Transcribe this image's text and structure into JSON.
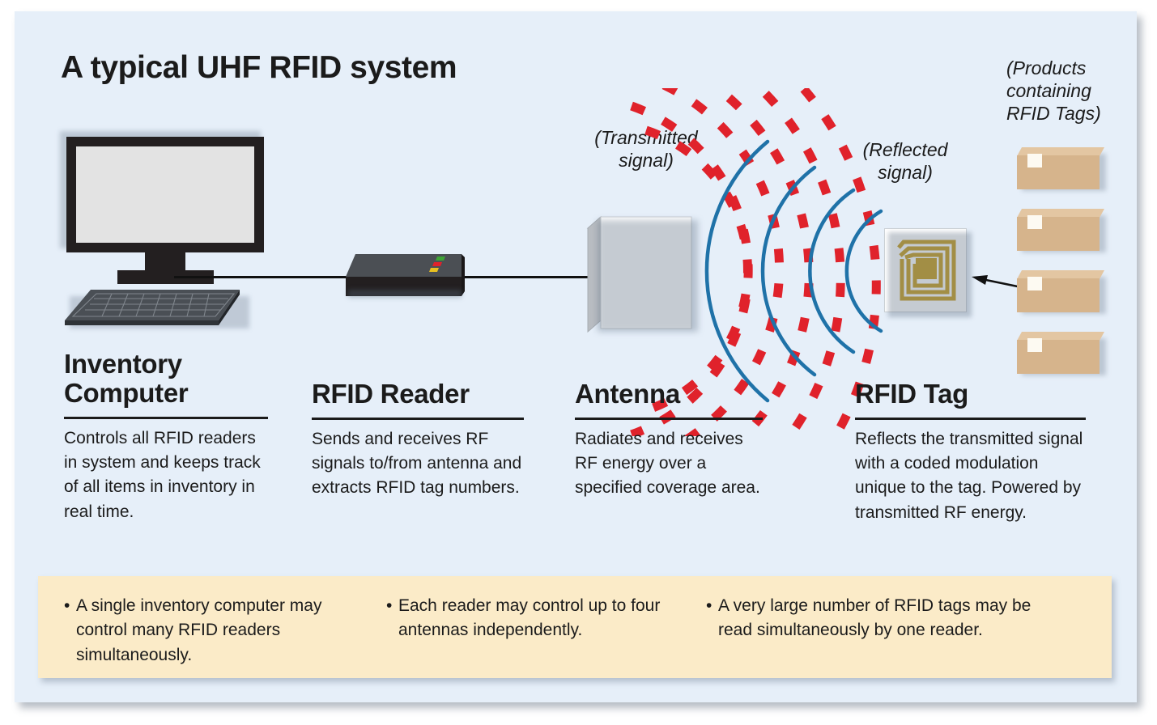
{
  "title": "A typical UHF RFID system",
  "colors": {
    "background": "#e6eff9",
    "transmitted_signal": "#e0222b",
    "reflected_signal": "#1f72a8",
    "tag_coil": "#c9a227",
    "box_fill": "#d6b48c",
    "notes_band": "#fbebc8",
    "text": "#1b1b1b"
  },
  "annotations": {
    "transmitted": "(Transmitted\nsignal)",
    "transmitted_line1": "(Transmitted",
    "transmitted_line2": "signal)",
    "reflected_line1": "(Reflected",
    "reflected_line2": "signal)",
    "products_line1": "(Products",
    "products_line2": "containing",
    "products_line3": "RFID Tags)"
  },
  "columns": [
    {
      "heading": "Inventory\nComputer",
      "heading_line1": "Inventory",
      "heading_line2": "Computer",
      "body": "Controls all RFID readers in system and keeps track of all items in inventory in real time."
    },
    {
      "heading": "RFID Reader",
      "heading_line1": "RFID Reader",
      "heading_line2": "",
      "body": "Sends and receives RF signals to/from antenna and extracts RFID tag numbers."
    },
    {
      "heading": "Antenna",
      "heading_line1": "Antenna",
      "heading_line2": "",
      "body": "Radiates and receives RF energy over a specified coverage area."
    },
    {
      "heading": "RFID Tag",
      "heading_line1": "RFID Tag",
      "heading_line2": "",
      "body": "Reflects the transmitted signal with a coded modulation unique to the tag. Powered by transmitted RF energy."
    }
  ],
  "notes": {
    "bullet": "•",
    "items": [
      "A single inventory computer may control many RFID readers simultaneously.",
      "Each reader may control up to four antennas independently.",
      "A very large number of RFID tags may be read simultaneously by one reader."
    ]
  },
  "graphics": {
    "computer_icon": "desktop-monitor-and-keyboard",
    "reader_icon": "rfid-reader-box-with-leds",
    "antenna_icon": "panel-antenna",
    "tag_icon": "rfid-tag-spiral-coil",
    "products_icon": "cardboard-boxes",
    "reader_leds": [
      "#3fa535",
      "#e0222b",
      "#e8c020"
    ],
    "product_box_count": 4,
    "transmitted_arc_count": 6,
    "reflected_arc_count": 4
  }
}
